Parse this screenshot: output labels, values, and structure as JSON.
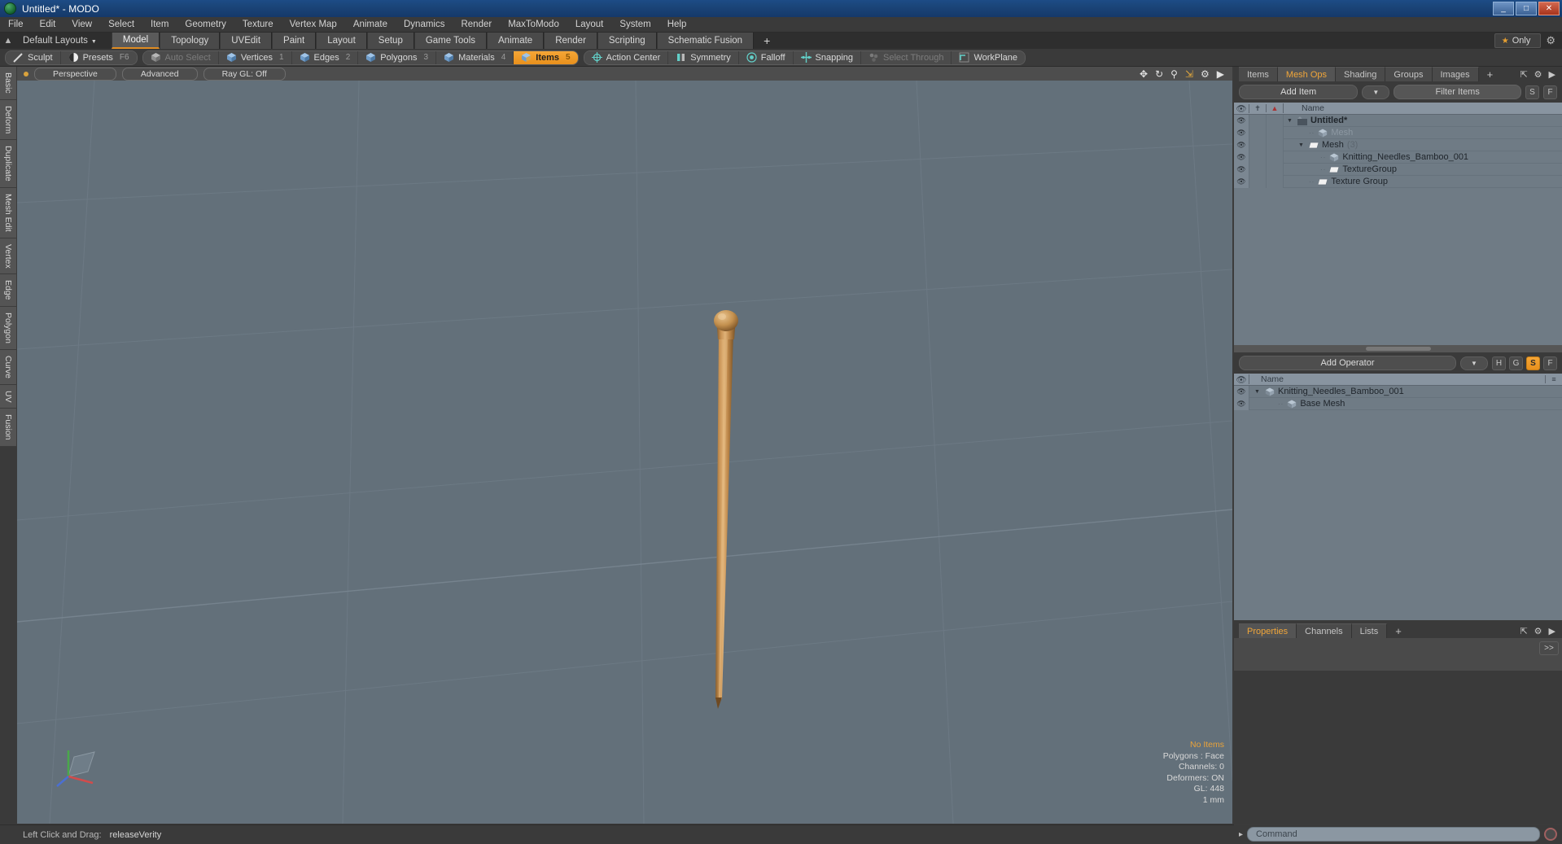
{
  "window": {
    "title": "Untitled* - MODO",
    "app_icon": "modo-logo-icon",
    "minimize": "_",
    "maximize": "□",
    "close": "✕"
  },
  "menubar": {
    "items": [
      "File",
      "Edit",
      "View",
      "Select",
      "Item",
      "Geometry",
      "Texture",
      "Vertex Map",
      "Animate",
      "Dynamics",
      "Render",
      "MaxToModo",
      "Layout",
      "System",
      "Help"
    ]
  },
  "layoutbar": {
    "home_icon": "home-icon",
    "layout_label": "Default Layouts",
    "caret": "▼",
    "tabs": [
      {
        "label": "Model",
        "active": true
      },
      {
        "label": "Topology",
        "active": false
      },
      {
        "label": "UVEdit",
        "active": false
      },
      {
        "label": "Paint",
        "active": false
      },
      {
        "label": "Layout",
        "active": false
      },
      {
        "label": "Setup",
        "active": false
      },
      {
        "label": "Game Tools",
        "active": false
      },
      {
        "label": "Animate",
        "active": false
      },
      {
        "label": "Render",
        "active": false
      },
      {
        "label": "Scripting",
        "active": false
      },
      {
        "label": "Schematic Fusion",
        "active": false
      }
    ],
    "add_tab": "+",
    "only_label": "Only",
    "star_icon": "star-icon",
    "gear_icon": "gear-icon"
  },
  "toolbar": {
    "group1": [
      {
        "label": "Sculpt",
        "icon": "sculpt-brush-icon",
        "shortcut": "",
        "state": "normal"
      },
      {
        "label": "Presets",
        "icon": "presets-sphere-icon",
        "shortcut": "F6",
        "state": "normal"
      }
    ],
    "group2": [
      {
        "label": "Auto Select",
        "icon": "cube-gray-icon",
        "shortcut": "",
        "state": "dim"
      },
      {
        "label": "Vertices",
        "icon": "cube-vertex-icon",
        "shortcut": "1",
        "state": "normal"
      },
      {
        "label": "Edges",
        "icon": "cube-edge-icon",
        "shortcut": "2",
        "state": "normal"
      },
      {
        "label": "Polygons",
        "icon": "cube-polygon-icon",
        "shortcut": "3",
        "state": "normal"
      },
      {
        "label": "Materials",
        "icon": "cube-material-icon",
        "shortcut": "4",
        "state": "normal"
      },
      {
        "label": "Items",
        "icon": "cube-items-icon",
        "shortcut": "5",
        "state": "active"
      }
    ],
    "group3": [
      {
        "label": "Action Center",
        "icon": "action-center-icon",
        "shortcut": "",
        "state": "normal"
      },
      {
        "label": "Symmetry",
        "icon": "symmetry-icon",
        "shortcut": "",
        "state": "normal"
      },
      {
        "label": "Falloff",
        "icon": "falloff-icon",
        "shortcut": "",
        "state": "normal"
      },
      {
        "label": "Snapping",
        "icon": "snapping-icon",
        "shortcut": "",
        "state": "normal"
      },
      {
        "label": "Select Through",
        "icon": "select-through-icon",
        "shortcut": "",
        "state": "dim"
      },
      {
        "label": "WorkPlane",
        "icon": "workplane-icon",
        "shortcut": "",
        "state": "normal"
      }
    ]
  },
  "vtabs": [
    "Basic",
    "Deform",
    "Duplicate",
    "Mesh Edit",
    "Vertex",
    "Edge",
    "Polygon",
    "Curve",
    "UV",
    "Fusion"
  ],
  "viewport": {
    "dot_icon": "viewport-indicator-dot",
    "pills": [
      "Perspective",
      "Advanced",
      "Ray GL: Off"
    ],
    "header_icons": [
      "move-icon",
      "rotate-icon",
      "zoom-icon",
      "fit-icon",
      "gear-icon",
      "expand-arrow-icon"
    ],
    "hud": {
      "items_status": "No Items",
      "polygons": "Polygons : Face",
      "channels": "Channels: 0",
      "deformers": "Deformers: ON",
      "gl": "GL: 448",
      "grid": "1 mm"
    },
    "axis": {
      "x": "X",
      "y": "Y",
      "z": "Z"
    },
    "background_color": "#63707a",
    "model_color": "#c08f52"
  },
  "right_panel": {
    "tabs": [
      {
        "label": "Items",
        "active": false
      },
      {
        "label": "Mesh Ops",
        "active": true
      },
      {
        "label": "Shading",
        "active": false
      },
      {
        "label": "Groups",
        "active": false
      },
      {
        "label": "Images",
        "active": false
      }
    ],
    "add_tab": "+",
    "panel_icons": [
      "expand-icon",
      "gear-icon",
      "menu-arrow-icon"
    ],
    "add_item_label": "Add Item",
    "dropdown_caret": "▼",
    "filter_placeholder": "Filter Items",
    "toggle_s": "S",
    "toggle_f": "F",
    "tree_header": {
      "eye": "eye-icon",
      "lock": "pin-icon",
      "render": "render-icon",
      "name": "Name"
    },
    "tree_rows": [
      {
        "label": "Untitled*",
        "icon": "scene-icon",
        "depth": 0,
        "expander": "▼",
        "bold": true,
        "dim": false,
        "count": ""
      },
      {
        "label": "Mesh",
        "icon": "mesh-icon",
        "depth": 1,
        "expander": "",
        "bold": false,
        "dim": true,
        "count": ""
      },
      {
        "label": "Mesh",
        "icon": "folder-icon",
        "depth": 1,
        "expander": "▼",
        "bold": false,
        "dim": false,
        "count": "(3)"
      },
      {
        "label": "Knitting_Needles_Bamboo_001",
        "icon": "mesh-icon",
        "depth": 2,
        "expander": "",
        "bold": false,
        "dim": false,
        "count": ""
      },
      {
        "label": "TextureGroup",
        "icon": "folder-icon",
        "depth": 2,
        "expander": "",
        "bold": false,
        "dim": false,
        "count": ""
      },
      {
        "label": "Texture Group",
        "icon": "folder-icon",
        "depth": 1,
        "expander": "",
        "bold": false,
        "dim": false,
        "count": ""
      }
    ]
  },
  "ops_panel": {
    "add_operator_label": "Add Operator",
    "dropdown_caret": "▼",
    "toggles": [
      {
        "label": "H",
        "on": false
      },
      {
        "label": "G",
        "on": false
      },
      {
        "label": "S",
        "on": true
      },
      {
        "label": "F",
        "on": false
      }
    ],
    "header": {
      "eye": "eye-icon",
      "name": "Name",
      "sort": "sort-icon"
    },
    "rows": [
      {
        "label": "Knitting_Needles_Bamboo_001",
        "icon": "mesh-icon",
        "depth": 0,
        "expander": "▼"
      },
      {
        "label": "Base Mesh",
        "icon": "mesh-icon",
        "depth": 1,
        "expander": ""
      }
    ]
  },
  "properties_panel": {
    "tabs": [
      {
        "label": "Properties",
        "active": true
      },
      {
        "label": "Channels",
        "active": false
      },
      {
        "label": "Lists",
        "active": false
      }
    ],
    "add_tab": "+",
    "panel_icons": [
      "expand-icon",
      "gear-icon",
      "menu-arrow-icon"
    ],
    "more_button": ">>"
  },
  "command_bar": {
    "prompt_icon": "chevron-right-icon",
    "placeholder": "Command",
    "record_icon": "record-circle-icon"
  },
  "statusbar": {
    "hint_label": "Left Click and Drag:",
    "hint_value": "releaseVerity"
  }
}
